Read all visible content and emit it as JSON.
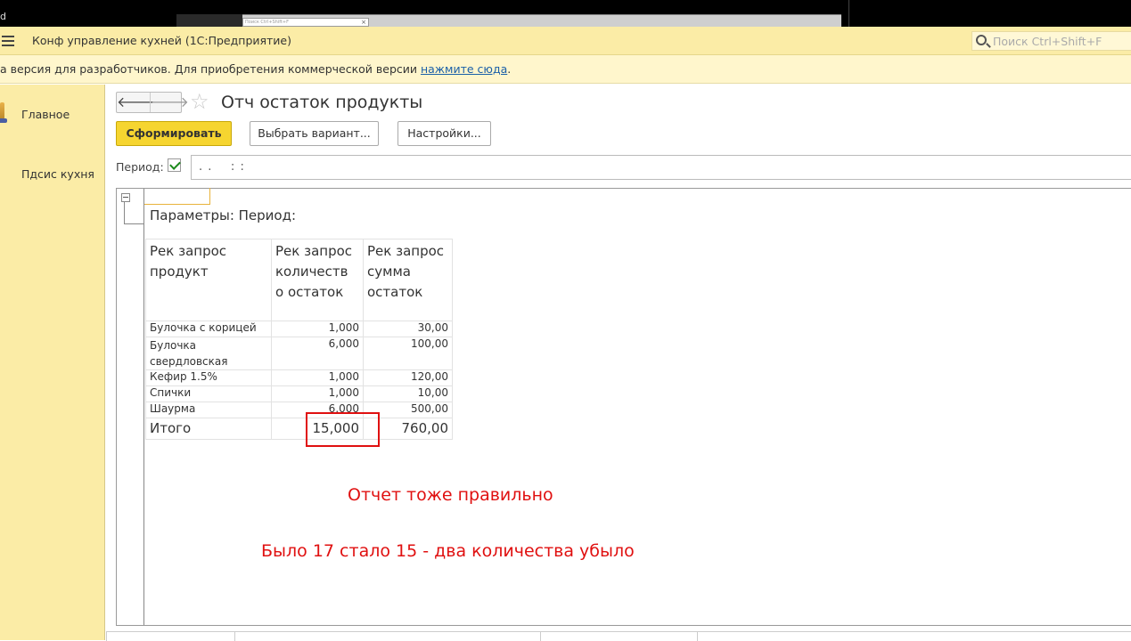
{
  "topstrip": {
    "left_fragment": "d",
    "thumb_placeholder": "Поиск Ctrl+Shift+F",
    "thumb_close": "×"
  },
  "titlebar": {
    "app_title": "Конф управление кухней  (1С:Предприятие)",
    "search_placeholder": "Поиск Ctrl+Shift+F"
  },
  "infobar": {
    "text": "а версия для разработчиков. Для приобретения коммерческой версии ",
    "link": "нажмите сюда",
    "tail": "."
  },
  "sidebar": {
    "items": [
      {
        "label": "Главное"
      },
      {
        "label": "Пдсис кухня"
      }
    ]
  },
  "form": {
    "back": "🡐",
    "forward": "🡒",
    "star": "☆",
    "title": "Отч остаток продукты",
    "generate_button": "Сформировать",
    "variant_button": "Выбрать вариант...",
    "settings_button": "Настройки...",
    "period_label": "Период:",
    "period_value": ". .    : :"
  },
  "report": {
    "params_text": "Параметры:  Период:",
    "headers": [
      "Рек запрос продукт",
      "Рек запрос количеств о остаток",
      "Рек запрос сумма остаток"
    ],
    "rows": [
      {
        "product": "Булочка с корицей",
        "qty": "1,000",
        "sum": "30,00"
      },
      {
        "product": "Булочка свердловская",
        "qty": "6,000",
        "sum": "100,00"
      },
      {
        "product": "Кефир 1.5%",
        "qty": "1,000",
        "sum": "120,00"
      },
      {
        "product": "Спички",
        "qty": "1,000",
        "sum": "10,00"
      },
      {
        "product": "Шаурма",
        "qty": "6,000",
        "sum": "500,00"
      }
    ],
    "total_label": "Итого",
    "total_qty": "15,000",
    "total_sum": "760,00",
    "note1": "Отчет тоже правильно",
    "note2": "Было 17 стало 15 - два количества убыло"
  },
  "colors": {
    "accent_yellow": "#f6d530",
    "panel_yellow": "#fbeca6",
    "annotation_red": "#e01010"
  }
}
